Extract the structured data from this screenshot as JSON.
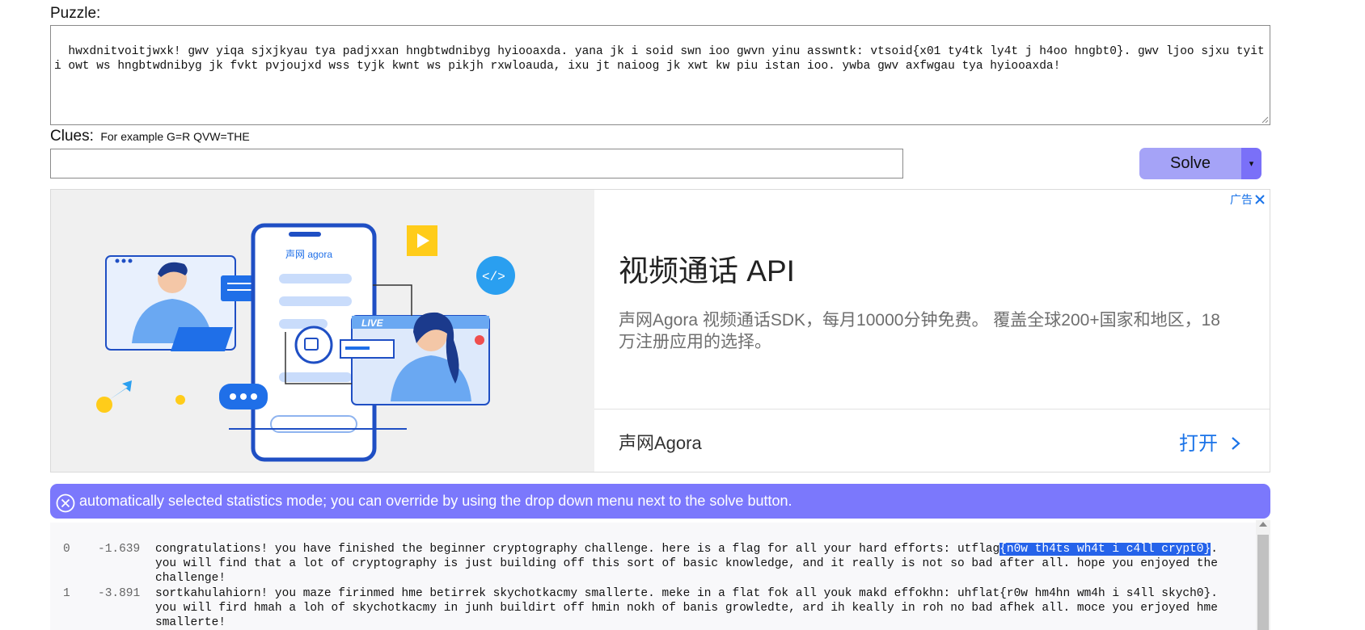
{
  "puzzle": {
    "label": "Puzzle:",
    "text": "hwxdnitvoitjwxk! gwv yiqa sjxjkyau tya padjxxan hngbtwdnibyg hyiooaxda. yana jk i soid swn ioo gwvn yinu asswntk: vtsoid{x01 ty4tk ly4t j h4oo hngbt0}. gwv ljoo sjxu tyit i owt ws hngbtwdnibyg jk fvkt pvjoujxd wss tyjk kwnt ws pikjh rxwloauda, ixu jt naioog jk xwt kw piu istan ioo. ywba gwv axfwgau tya hyiooaxda!"
  },
  "clues": {
    "label": "Clues:",
    "hint": "For example G=R QVW=THE",
    "value": ""
  },
  "solve": {
    "label": "Solve",
    "dropdown_icon": "▾"
  },
  "ad": {
    "badge": "广告",
    "headline": "视频通话 API",
    "body": "声网Agora 视频通话SDK，每月10000分钟免费。 覆盖全球200+国家和地区，18万注册应用的选择。",
    "advertiser": "声网Agora",
    "open": "打开",
    "illustration": {
      "logo": "声网 agora",
      "live": "LIVE"
    }
  },
  "notice": {
    "text": "automatically selected statistics mode; you can override by using the drop down menu next to the solve button."
  },
  "results": [
    {
      "index": "0",
      "score": "-1.639",
      "before": "congratulations! you have finished the beginner cryptography challenge. here is a flag for all your hard efforts: utflag",
      "highlight": "{n0w th4ts wh4t i c4ll crypt0}",
      "after": ". you will find that a lot of cryptography is just building off this sort of basic knowledge, and it really is not so bad after all. hope you enjoyed the challenge!"
    },
    {
      "index": "1",
      "score": "-3.891",
      "before": "sortkahulahiorn! you maze firinmed hme betirrek skychotkacmy smallerte. meke in a flat fok all youk makd effokhn: uhflat{r0w hm4hn wm4h i s4ll skych0}. you will fird hmah a loh of skychotkacmy in junh buildirt off hmin nokh of banis growledte, ard ih keally in roh no bad afhek all. moce you erjoyed hme smallerte!",
      "highlight": "",
      "after": ""
    }
  ],
  "colors": {
    "accent": "#7b78fc",
    "solve_bg": "#a5a3f7",
    "highlight": "#2563ea",
    "link": "#1a73e8"
  }
}
